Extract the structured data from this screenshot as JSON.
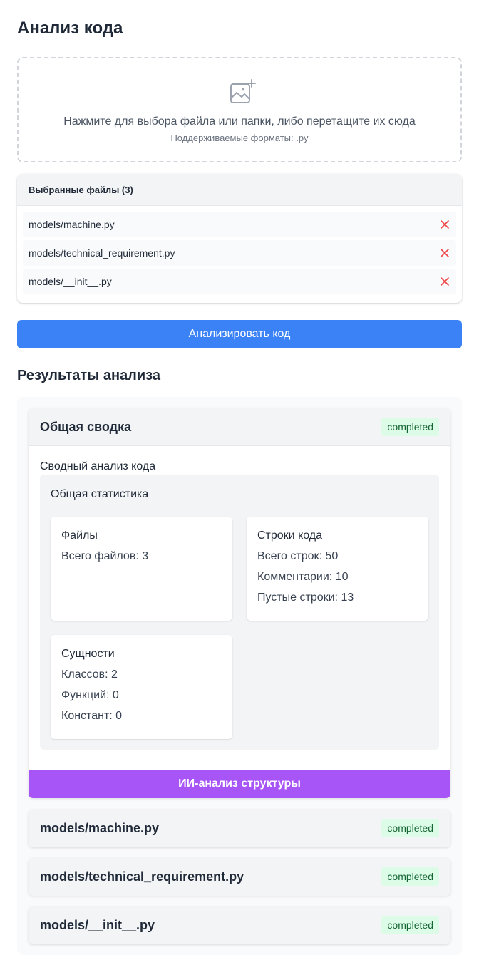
{
  "page": {
    "title": "Анализ кода"
  },
  "upload": {
    "icon": "image-add-icon",
    "instruction": "Нажмите для выбора файла или папки, либо перетащите их сюда",
    "formats": "Поддерживаемые форматы: .py"
  },
  "selected_files": {
    "header": "Выбранные файлы (3)",
    "items": [
      {
        "name": "models/machine.py"
      },
      {
        "name": "models/technical_requirement.py"
      },
      {
        "name": "models/__init__.py"
      }
    ],
    "remove_icon": "close-icon",
    "remove_color": "#ef4444"
  },
  "analyze_button": {
    "label": "Анализировать код",
    "color": "#3b82f6"
  },
  "results": {
    "title": "Результаты анализа",
    "summary": {
      "title": "Общая сводка",
      "status": "completed",
      "subtitle": "Сводный анализ кода",
      "stats_title": "Общая статистика",
      "files": {
        "heading": "Файлы",
        "total": "Всего файлов: 3"
      },
      "lines": {
        "heading": "Строки кода",
        "total": "Всего строк: 50",
        "comments": "Комментарии: 10",
        "blank": "Пустые строки: 13"
      },
      "entities": {
        "heading": "Сущности",
        "classes": "Классов: 2",
        "functions": "Функций: 0",
        "constants": "Констант: 0"
      },
      "ai_button": {
        "label": "ИИ-анализ структуры",
        "color": "#a855f7"
      }
    },
    "file_results": [
      {
        "name": "models/machine.py",
        "status": "completed"
      },
      {
        "name": "models/technical_requirement.py",
        "status": "completed"
      },
      {
        "name": "models/__init__.py",
        "status": "completed"
      }
    ]
  }
}
